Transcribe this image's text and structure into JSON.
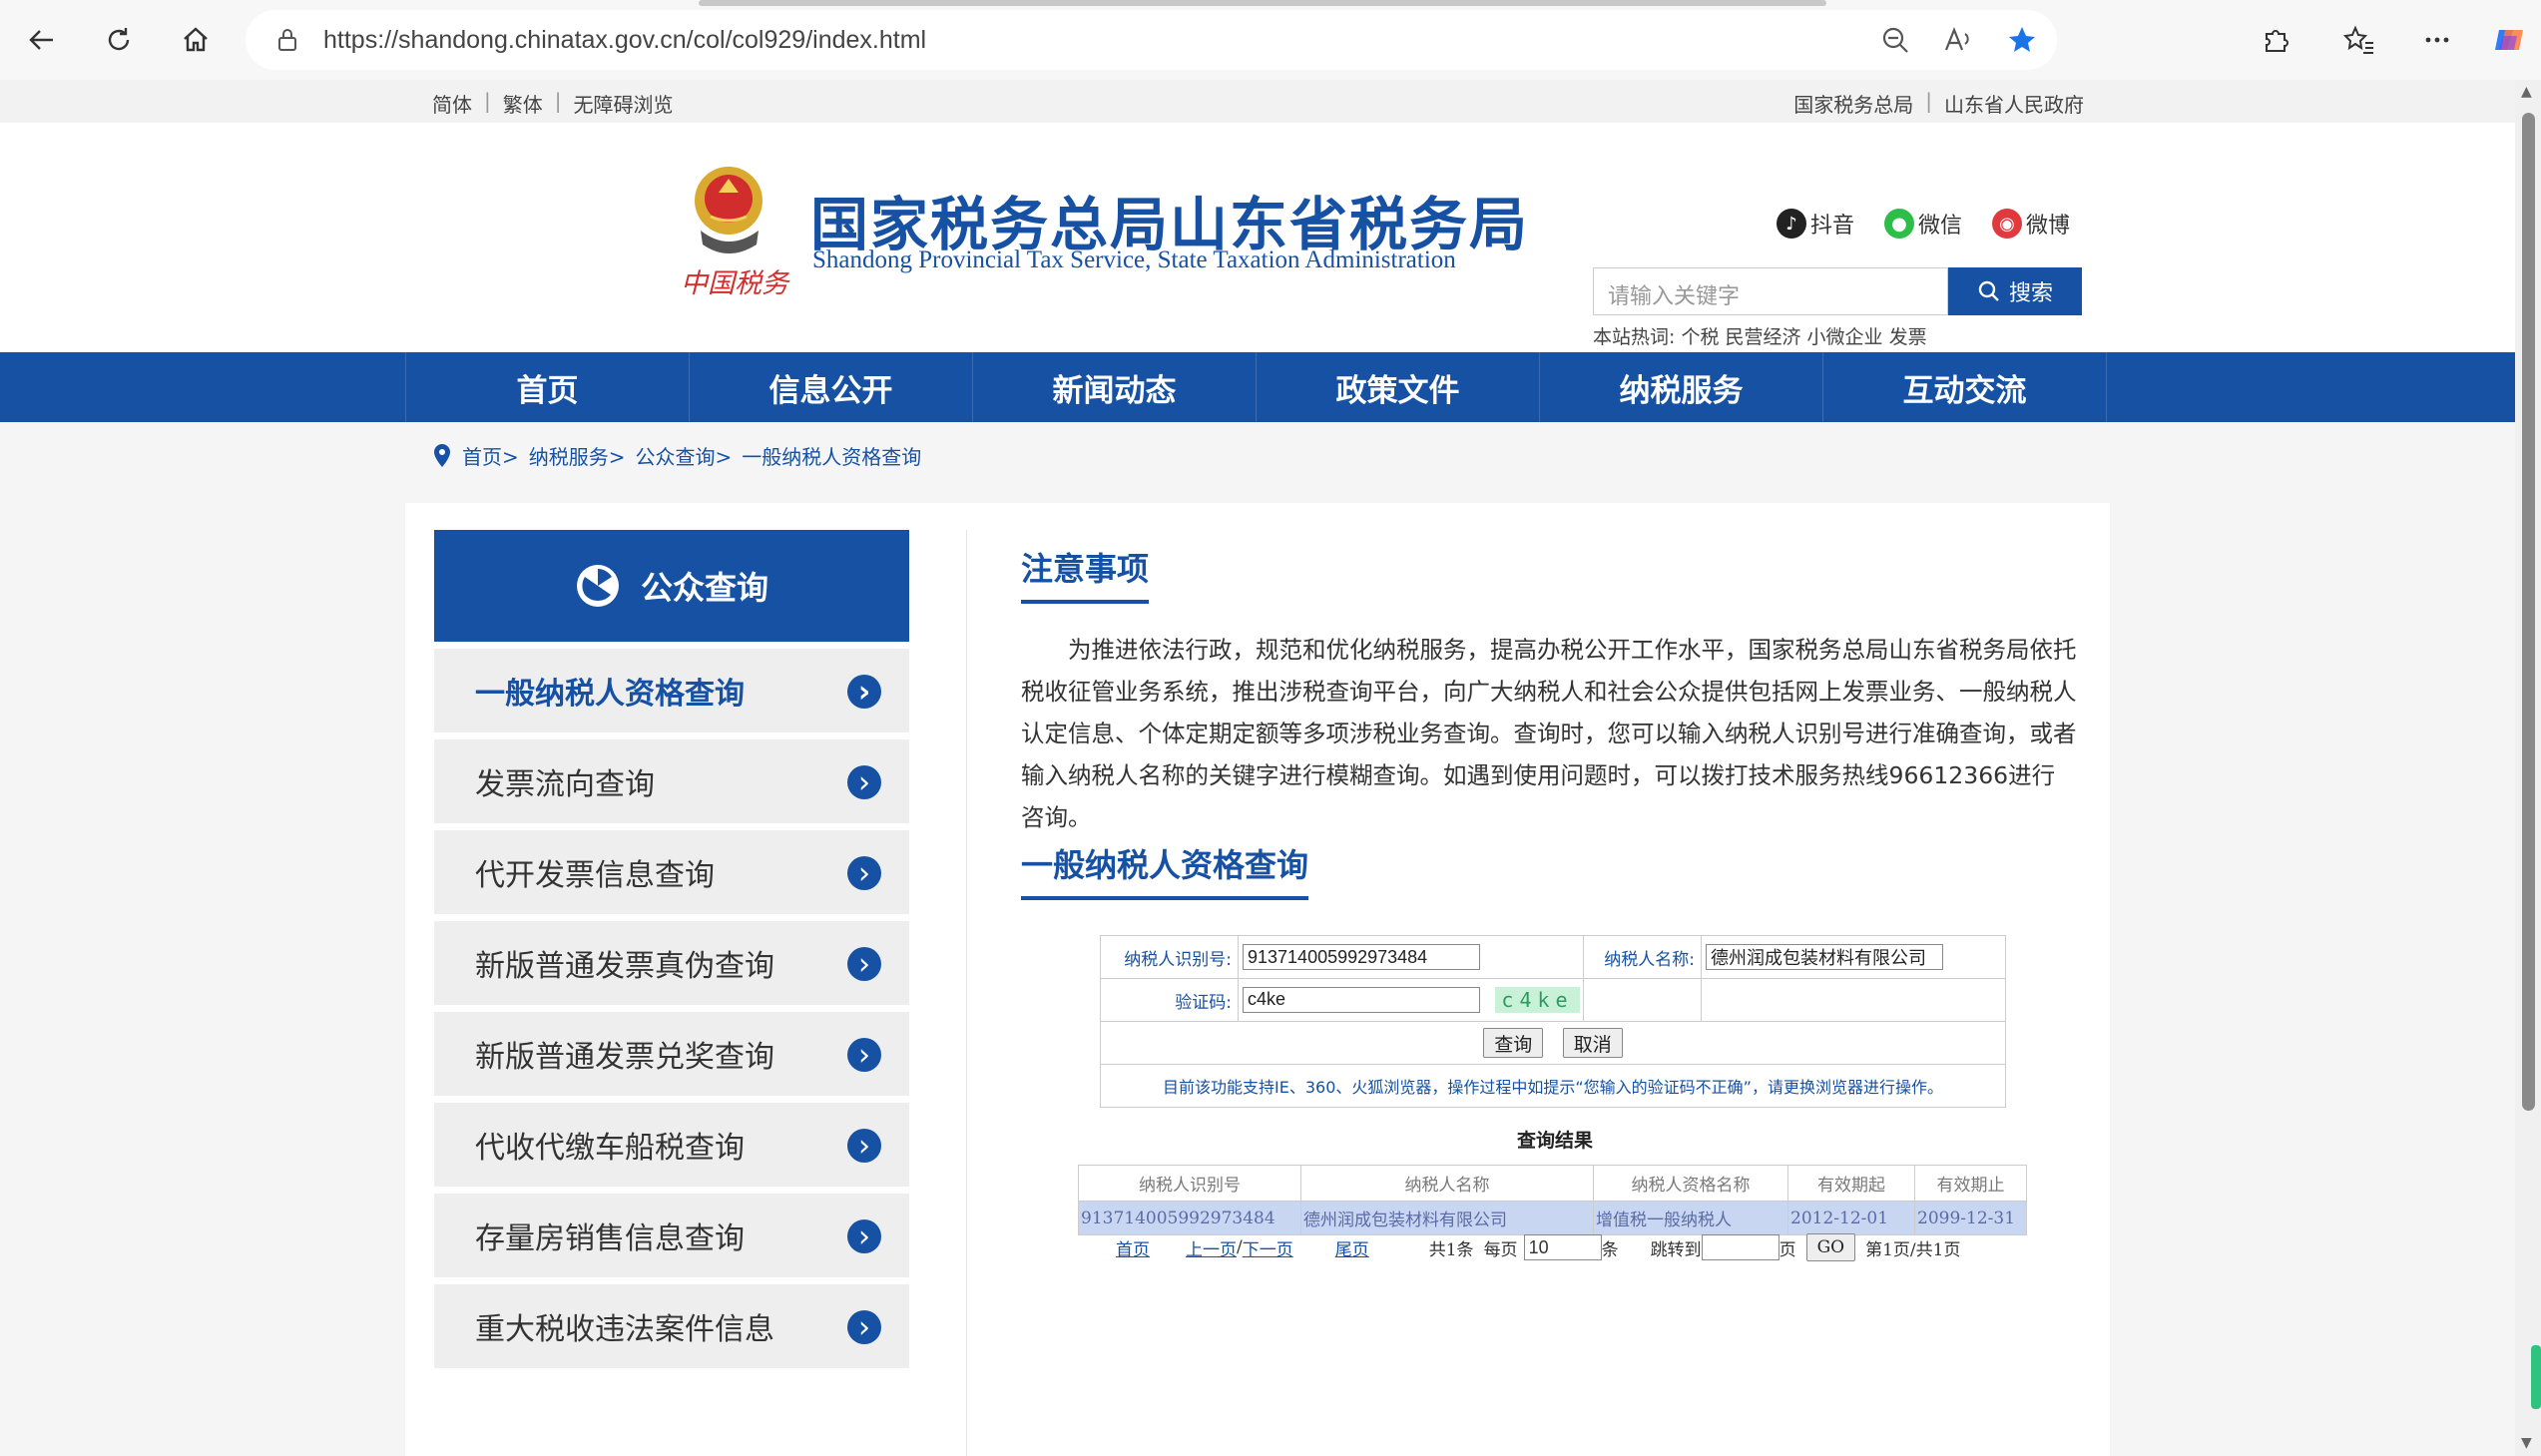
{
  "browser": {
    "url": "https://shandong.chinatax.gov.cn/col/col929/index.html"
  },
  "topstrip": {
    "left": [
      "简体",
      "繁体",
      "无障碍浏览"
    ],
    "right": [
      "国家税务总局",
      "山东省人民政府"
    ],
    "sep": "|"
  },
  "header": {
    "title": "国家税务总局山东省税务局",
    "subtitle": "Shandong Provincial Tax Service, State Taxation Administration",
    "emblem_text": "中国税务",
    "social": [
      "抖音",
      "微信",
      "微博"
    ],
    "search_placeholder": "请输入关键字",
    "search_button": "搜索",
    "hotwords_label": "本站热词:",
    "hotwords": "个税 民营经济 小微企业 发票"
  },
  "nav": [
    "首页",
    "信息公开",
    "新闻动态",
    "政策文件",
    "纳税服务",
    "互动交流"
  ],
  "breadcrumb": [
    "首页>",
    "纳税服务>",
    "公众查询>",
    "一般纳税人资格查询"
  ],
  "sidebar": {
    "title": "公众查询",
    "items": [
      {
        "label": "一般纳税人资格查询",
        "active": true
      },
      {
        "label": "发票流向查询"
      },
      {
        "label": "代开发票信息查询"
      },
      {
        "label": "新版普通发票真伪查询"
      },
      {
        "label": "新版普通发票兑奖查询"
      },
      {
        "label": "代收代缴车船税查询"
      },
      {
        "label": "存量房销售信息查询"
      },
      {
        "label": "重大税收违法案件信息"
      }
    ]
  },
  "main": {
    "notice_title": "注意事项",
    "notice_text": "为推进依法行政，规范和优化纳税服务，提高办税公开工作水平，国家税务总局山东省税务局依托税收征管业务系统，推出涉税查询平台，向广大纳税人和社会公众提供包括网上发票业务、一般纳税人认定信息、个体定期定额等多项涉税业务查询。查询时，您可以输入纳税人识别号进行准确查询，或者输入纳税人名称的关键字进行模糊查询。如遇到使用问题时，可以拨打技术服务热线96612366进行咨询。",
    "query_title": "一般纳税人资格查询",
    "form": {
      "id_label": "纳税人识别号:",
      "id_value": "913714005992973484",
      "name_label": "纳税人名称:",
      "name_value": "德州润成包装材料有限公司",
      "captcha_label": "验证码:",
      "captcha_value": "c4ke",
      "captcha_image_text": "c4ke",
      "query_button": "查询",
      "cancel_button": "取消",
      "tip": "目前该功能支持IE、360、火狐浏览器，操作过程中如提示“您输入的验证码不正确”，请更换浏览器进行操作。"
    },
    "result_title": "查询结果",
    "result_headers": [
      "纳税人识别号",
      "纳税人名称",
      "纳税人资格名称",
      "有效期起",
      "有效期止"
    ],
    "result_rows": [
      [
        "913714005992973484",
        "德州润成包装材料有限公司",
        "增值税一般纳税人",
        "2012-12-01",
        "2099-12-31"
      ]
    ],
    "pager": {
      "first": "首页",
      "prev": "上一页",
      "slash": "/",
      "next": "下一页",
      "last": "尾页",
      "total": "共1条",
      "per_page_label": "每页",
      "per_page_value": "10",
      "per_page_unit": "条",
      "jump_label": "跳转到",
      "jump_unit": "页",
      "go": "GO",
      "page_info": "第1页/共1页"
    }
  }
}
